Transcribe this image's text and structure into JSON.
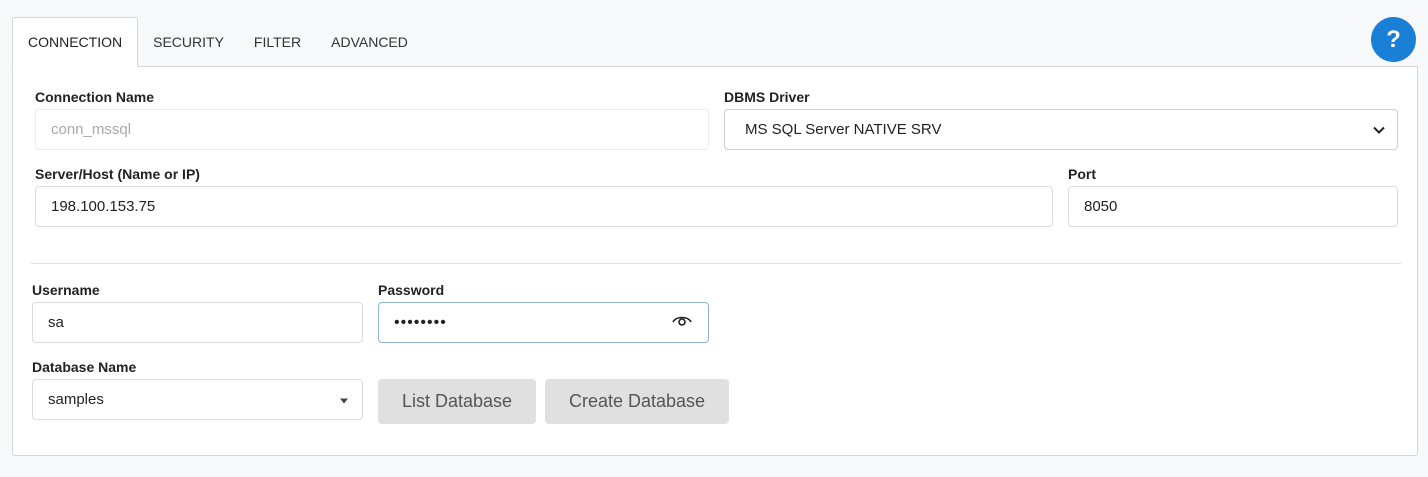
{
  "tabs": [
    {
      "label": "CONNECTION",
      "active": true
    },
    {
      "label": "SECURITY",
      "active": false
    },
    {
      "label": "FILTER",
      "active": false
    },
    {
      "label": "ADVANCED",
      "active": false
    }
  ],
  "help": {
    "label": "?"
  },
  "form": {
    "connection_name": {
      "label": "Connection Name",
      "placeholder": "conn_mssql",
      "value": ""
    },
    "dbms_driver": {
      "label": "DBMS Driver",
      "value": "MS SQL Server NATIVE SRV"
    },
    "server_host": {
      "label": "Server/Host (Name or IP)",
      "value": "198.100.153.75"
    },
    "port": {
      "label": "Port",
      "value": "8050"
    },
    "username": {
      "label": "Username",
      "value": "sa"
    },
    "password": {
      "label": "Password",
      "masked": "••••••••"
    },
    "database_name": {
      "label": "Database Name",
      "value": "samples"
    }
  },
  "buttons": {
    "list_database": "List Database",
    "create_database": "Create Database"
  },
  "colors": {
    "accent": "#1a7fd6",
    "button_bg": "#e0e0e0"
  }
}
